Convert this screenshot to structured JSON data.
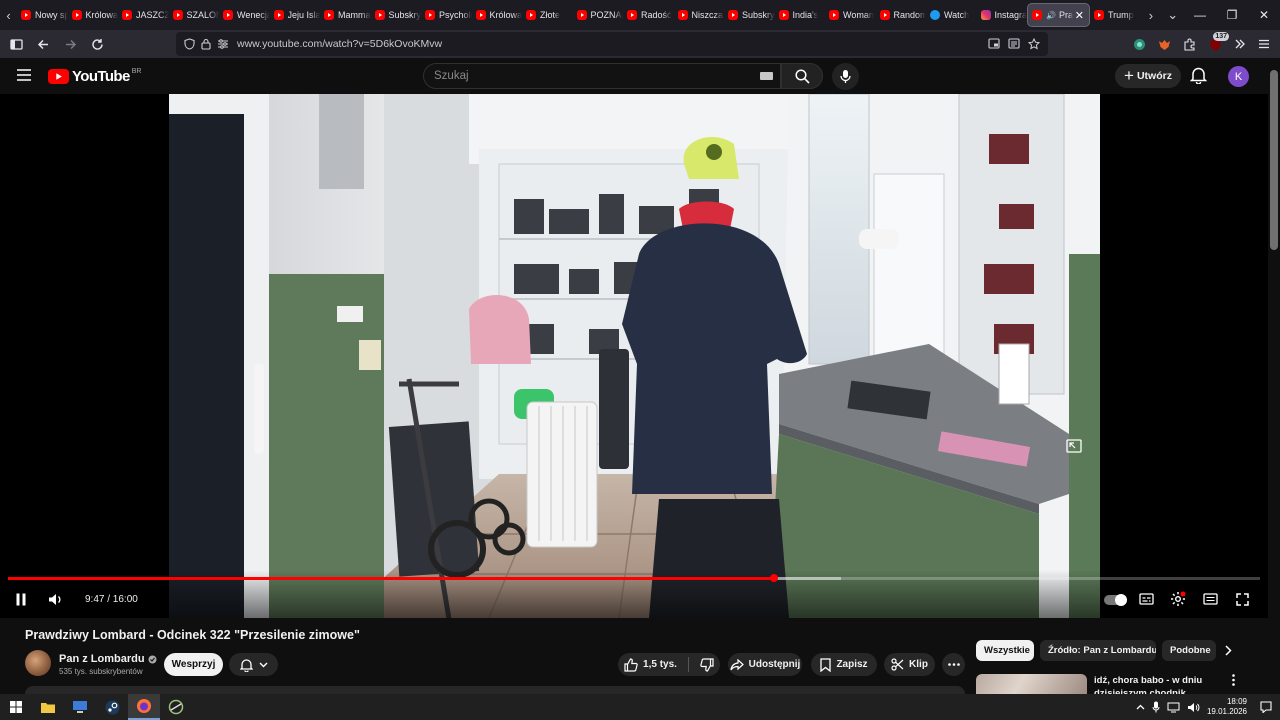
{
  "browser": {
    "tabs": [
      {
        "title": "Nowy spór",
        "icon": "youtube"
      },
      {
        "title": "Królowa",
        "icon": "youtube"
      },
      {
        "title": "JASZCZUR",
        "icon": "youtube"
      },
      {
        "title": "SZALONY",
        "icon": "youtube"
      },
      {
        "title": "Wenecja",
        "icon": "youtube"
      },
      {
        "title": "Jeju Island",
        "icon": "youtube"
      },
      {
        "title": "Mamma",
        "icon": "youtube"
      },
      {
        "title": "Subskrypcje",
        "icon": "youtube"
      },
      {
        "title": "Psychologia",
        "icon": "youtube"
      },
      {
        "title": "Królowa",
        "icon": "youtube"
      },
      {
        "title": "Złote",
        "icon": "youtube"
      },
      {
        "title": "POZNAŃ",
        "icon": "youtube"
      },
      {
        "title": "Radość",
        "icon": "youtube"
      },
      {
        "title": "Niszczarka",
        "icon": "youtube"
      },
      {
        "title": "Subskrypcje",
        "icon": "youtube"
      },
      {
        "title": "India's",
        "icon": "youtube"
      },
      {
        "title": "Woman",
        "icon": "youtube"
      },
      {
        "title": "Random",
        "icon": "youtube"
      },
      {
        "title": "Watch",
        "icon": "twitter"
      },
      {
        "title": "Instagram",
        "icon": "instagram"
      },
      {
        "title": "Prawdziwy",
        "icon": "youtube",
        "active": true
      },
      {
        "title": "Trump",
        "icon": "youtube"
      }
    ],
    "url": "www.youtube.com/watch?v=5D6kOvoKMvw",
    "extension_badge": "137"
  },
  "masthead": {
    "logo_text": "YouTube",
    "country_code": "BR",
    "search_placeholder": "Szukaj",
    "create_label": "Utwórz",
    "avatar_letter": "K",
    "avatar_color": "#7e4ccb"
  },
  "player": {
    "current_time": "9:47",
    "duration": "16:00",
    "time_display": "9:47 / 16:00",
    "played_fraction": 0.612,
    "buffered_fraction": 0.665,
    "accent": "#ff0000"
  },
  "video": {
    "title": "Prawdziwy Lombard - Odcinek 322 \"Przesilenie zimowe\"",
    "channel_name": "Pan z Lombardu",
    "subscribers": "535 tys. subskrybentów",
    "support_label": "Wesprzyj",
    "likes": "1,5 tys.",
    "share_label": "Udostępnij",
    "save_label": "Zapisz",
    "clip_label": "Klip"
  },
  "sidebar": {
    "chips": [
      "Wszystkie",
      "Źródło: Pan z Lombardu",
      "Podobne"
    ],
    "recommendation_title": "idź, chora babo - w dniu dzisiejszym chodnik niszczym"
  },
  "taskbar": {
    "time": "18:09",
    "date": "19.01.2026"
  }
}
